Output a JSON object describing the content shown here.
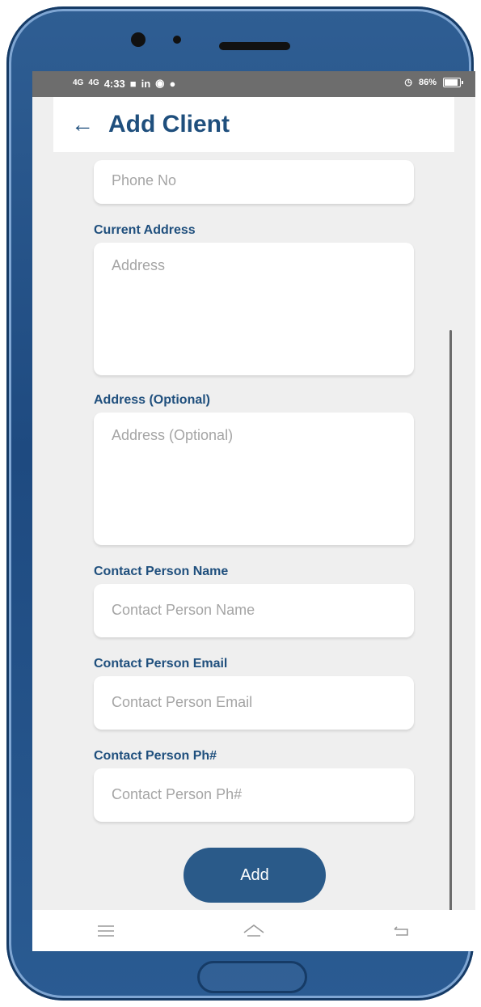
{
  "status_bar": {
    "signal_1": "4G",
    "signal_2": "4G",
    "time": "4:33",
    "linkedin": "in",
    "battery_percent": "86%"
  },
  "header": {
    "back_icon": "arrow-left-icon",
    "title": "Add Client"
  },
  "form": {
    "phone": {
      "placeholder": "Phone No"
    },
    "current_address": {
      "label": "Current Address",
      "placeholder": "Address"
    },
    "address_optional": {
      "label": "Address (Optional)",
      "placeholder": "Address (Optional)"
    },
    "contact_name": {
      "label": "Contact Person Name",
      "placeholder": "Contact Person Name"
    },
    "contact_email": {
      "label": "Contact Person Email",
      "placeholder": "Contact Person Email"
    },
    "contact_phone": {
      "label": "Contact Person Ph#",
      "placeholder": "Contact Person Ph#"
    }
  },
  "actions": {
    "add_label": "Add"
  },
  "nav": {
    "menu_icon": "menu-icon",
    "home_icon": "home-icon",
    "back_icon": "back-nav-icon"
  },
  "colors": {
    "primary": "#1f4f7d",
    "button": "#2a5a89",
    "background": "#efefef"
  }
}
